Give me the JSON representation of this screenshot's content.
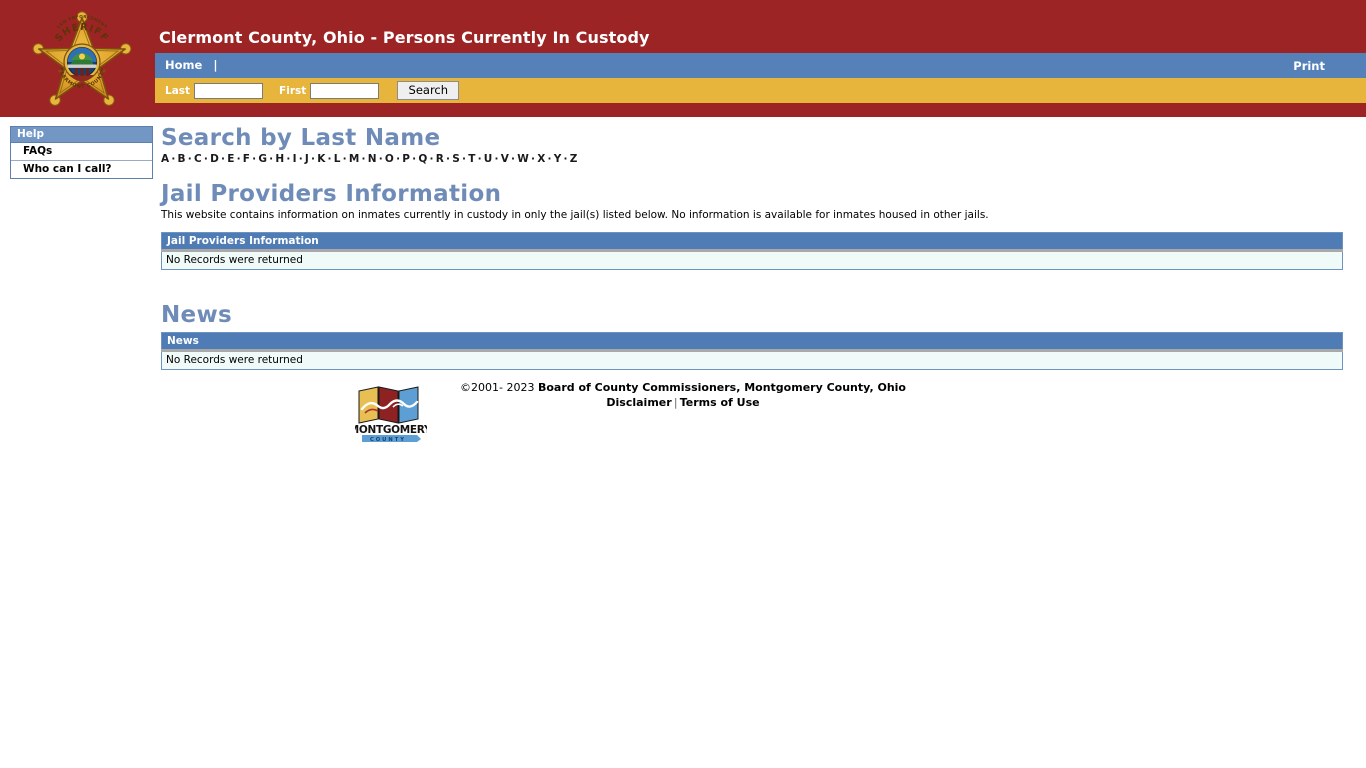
{
  "header": {
    "title": "Clermont County, Ohio - Persons Currently In Custody",
    "badge_icon": "sheriff-star-badge-icon",
    "badge_text_top": "SHERIFF",
    "badge_text_bottom": "CLERMONT COUNTY",
    "colors": {
      "header_red": "#9c2424",
      "nav_blue": "#5580b8",
      "search_gold": "#e8b53c",
      "heading_blue": "#6f8cb8",
      "table_header_blue": "#4f7cb5",
      "table_body": "#f0faf8"
    }
  },
  "nav": {
    "home_label": "Home",
    "separator": "|",
    "print_label": "Print"
  },
  "search": {
    "last_label": "Last",
    "last_value": "",
    "last_placeholder": "",
    "first_label": "First",
    "first_value": "",
    "first_placeholder": "",
    "button_label": "Search"
  },
  "sidebar": {
    "header": "Help",
    "items": [
      {
        "label": "FAQs"
      },
      {
        "label": "Who can I call?"
      }
    ]
  },
  "main": {
    "search_heading": "Search by Last Name",
    "alphabet": [
      "A",
      "B",
      "C",
      "D",
      "E",
      "F",
      "G",
      "H",
      "I",
      "J",
      "K",
      "L",
      "M",
      "N",
      "O",
      "P",
      "Q",
      "R",
      "S",
      "T",
      "U",
      "V",
      "W",
      "X",
      "Y",
      "Z"
    ],
    "alphabet_separator": "·",
    "jail": {
      "heading": "Jail Providers Information",
      "intro": "This website contains information on inmates currently in custody in only the jail(s) listed below. No information is available for inmates housed in other jails.",
      "table_header": "Jail Providers Information",
      "empty_message": "No Records were returned"
    },
    "news": {
      "heading": "News",
      "table_header": "News",
      "empty_message": "No Records were returned"
    }
  },
  "footer": {
    "logo_icon": "montgomery-county-logo-icon",
    "logo_text_main": "MONTGOMERY",
    "logo_text_sub": "C O U N T Y",
    "copyright_years": "©2001- 2023",
    "board_text": "Board of County Commissioners, Montgomery County, Ohio",
    "disclaimer_label": "Disclaimer",
    "pipe": "|",
    "terms_label": "Terms of Use"
  }
}
